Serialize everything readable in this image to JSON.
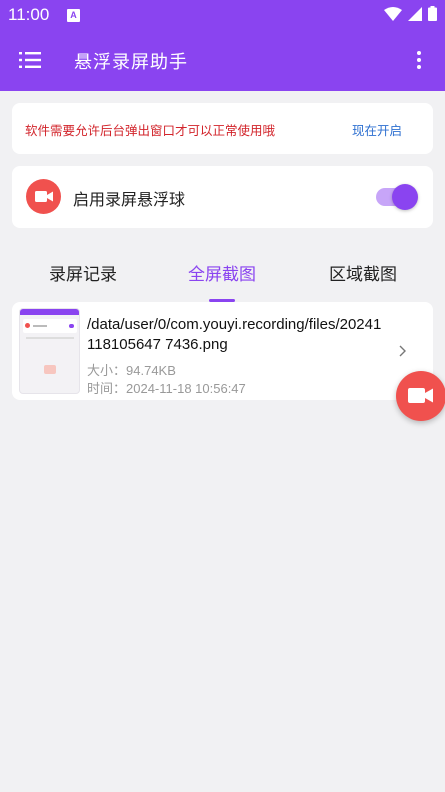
{
  "status_bar": {
    "time": "11:00",
    "notification_letter": "A",
    "icons": [
      "wifi-icon",
      "signal-icon",
      "battery-icon"
    ]
  },
  "appbar": {
    "title": "悬浮录屏助手",
    "menu_icon": "list-menu-icon",
    "more_icon": "more-vert-icon"
  },
  "notice": {
    "text": "软件需要允许后台弹出窗口才可以正常使用哦",
    "action": "现在开启"
  },
  "floating_toggle": {
    "label": "启用录屏悬浮球",
    "enabled": true
  },
  "tabs": [
    {
      "label": "录屏记录",
      "active": false
    },
    {
      "label": "全屏截图",
      "active": true
    },
    {
      "label": "区域截图",
      "active": false
    }
  ],
  "files": [
    {
      "path": "/data/user/0/com.youyi.recording/files/20241118105647 7436.png",
      "size_label": "大小：",
      "size_value": "94.74KB",
      "time_label": "时间：",
      "time_value": "2024-11-18 10:56:47"
    }
  ],
  "colors": {
    "primary": "#8a44f0",
    "accent_red": "#f0514e",
    "notice_red": "#d2242b",
    "link_blue": "#2d6fd0",
    "background": "#f1f1f3"
  }
}
